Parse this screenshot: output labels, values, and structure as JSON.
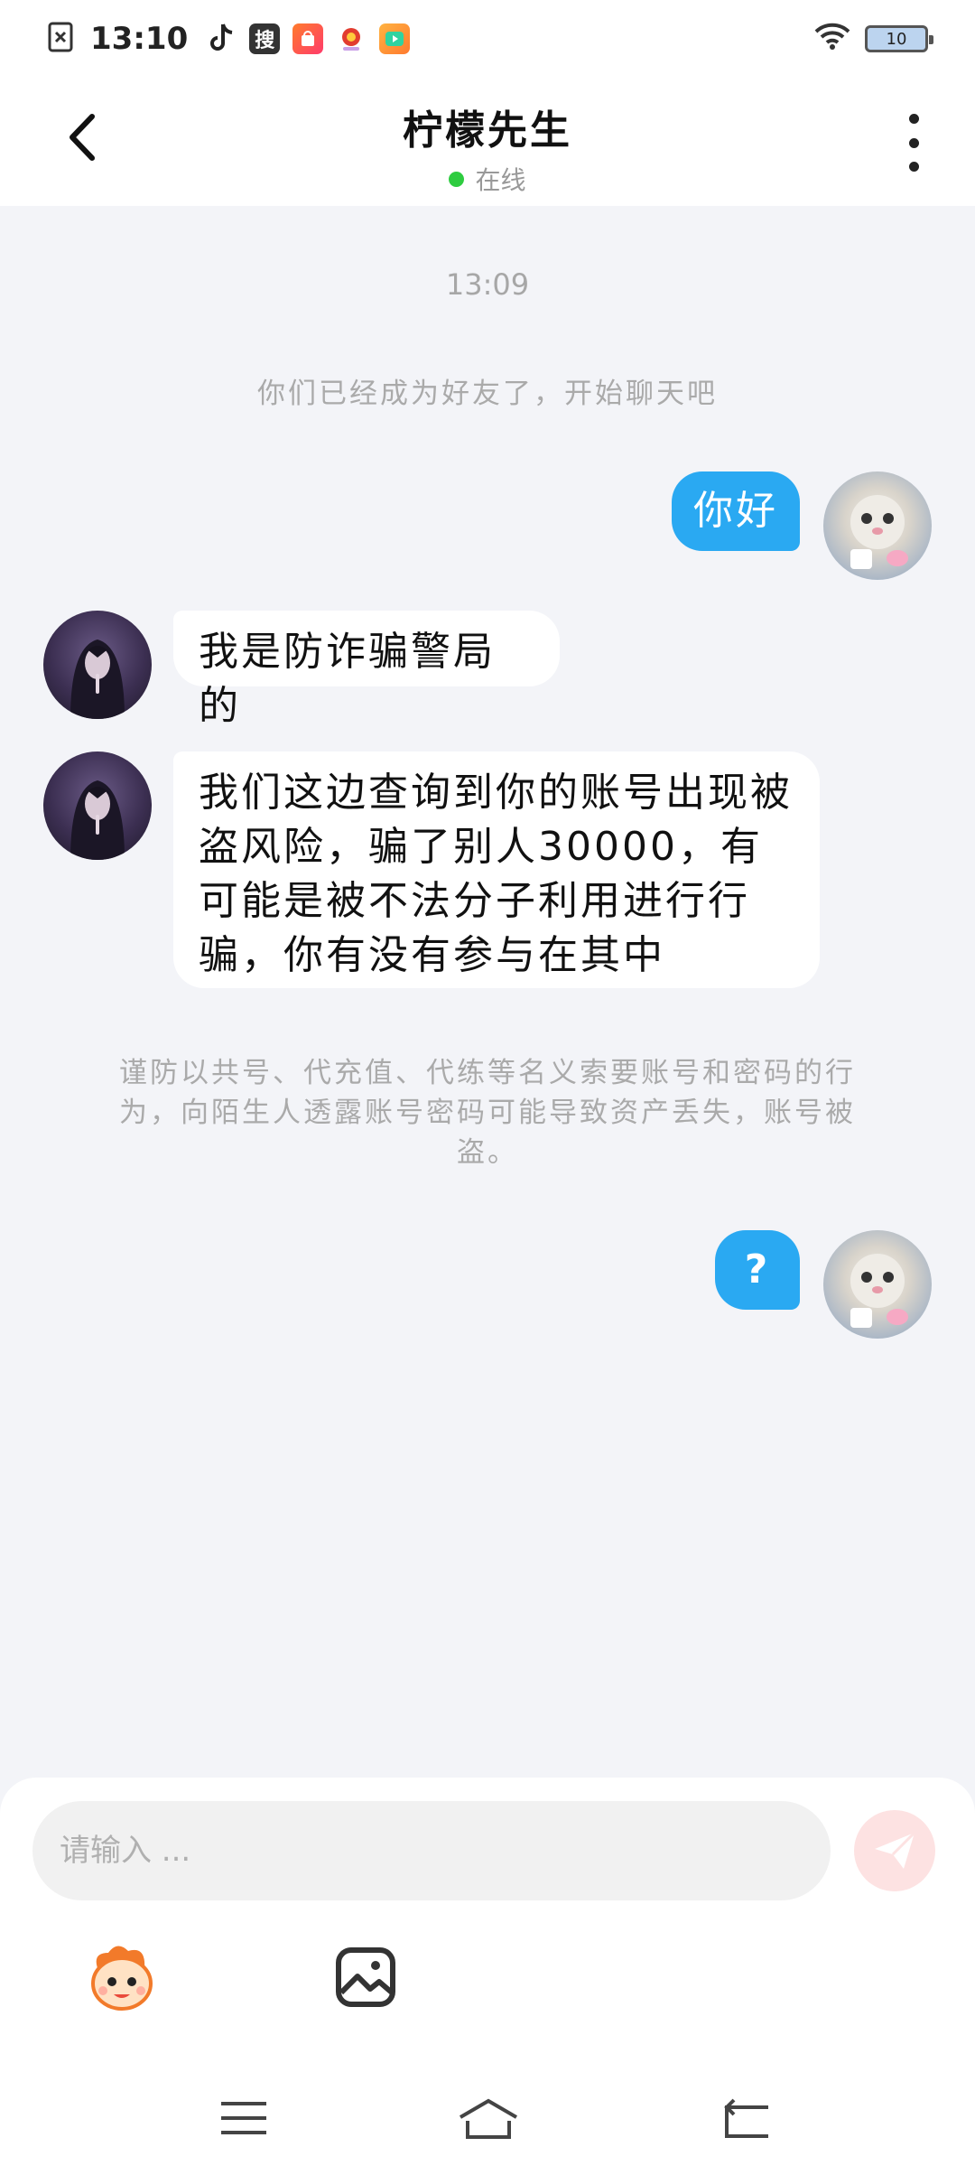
{
  "status_bar": {
    "time": "13:10",
    "app_icons": [
      "file-close-icon",
      "tiktok-icon",
      "sogou-search-icon",
      "shopping-app-icon",
      "news-app-icon",
      "video-app-icon"
    ],
    "sogou_label": "搜",
    "battery": "10"
  },
  "header": {
    "title": "柠檬先生",
    "status": "在线",
    "status_color": "#2ecc40"
  },
  "chat": {
    "timestamp": "13:09",
    "friend_notice": "你们已经成为好友了，开始聊天吧",
    "messages": [
      {
        "sender": "me",
        "text": "你好"
      },
      {
        "sender": "other",
        "text": "我是防诈骗警局的"
      },
      {
        "sender": "other",
        "text": "我们这边查询到你的账号出现被盗风险，骗了别人30000，有可能是被不法分子利用进行行骗，你有没有参与在其中"
      },
      {
        "sender": "me",
        "text": "?"
      }
    ],
    "warning": "谨防以共号、代充值、代练等名义索要账号和密码的行为，向陌生人透露账号密码可能导致资产丢失，账号被盗。"
  },
  "input": {
    "placeholder": "请输入 ..."
  },
  "colors": {
    "my_bubble": "#2aa9f2",
    "background": "#f3f4f8",
    "send_button": "#fde2e2"
  },
  "icons": {
    "back": "chevron-left-icon",
    "more": "more-vertical-icon",
    "send": "paper-plane-icon",
    "emoji": "mascot-emoji-icon",
    "image": "image-icon",
    "nav_menu": "menu-icon",
    "nav_home": "home-icon",
    "nav_back": "back-icon"
  }
}
